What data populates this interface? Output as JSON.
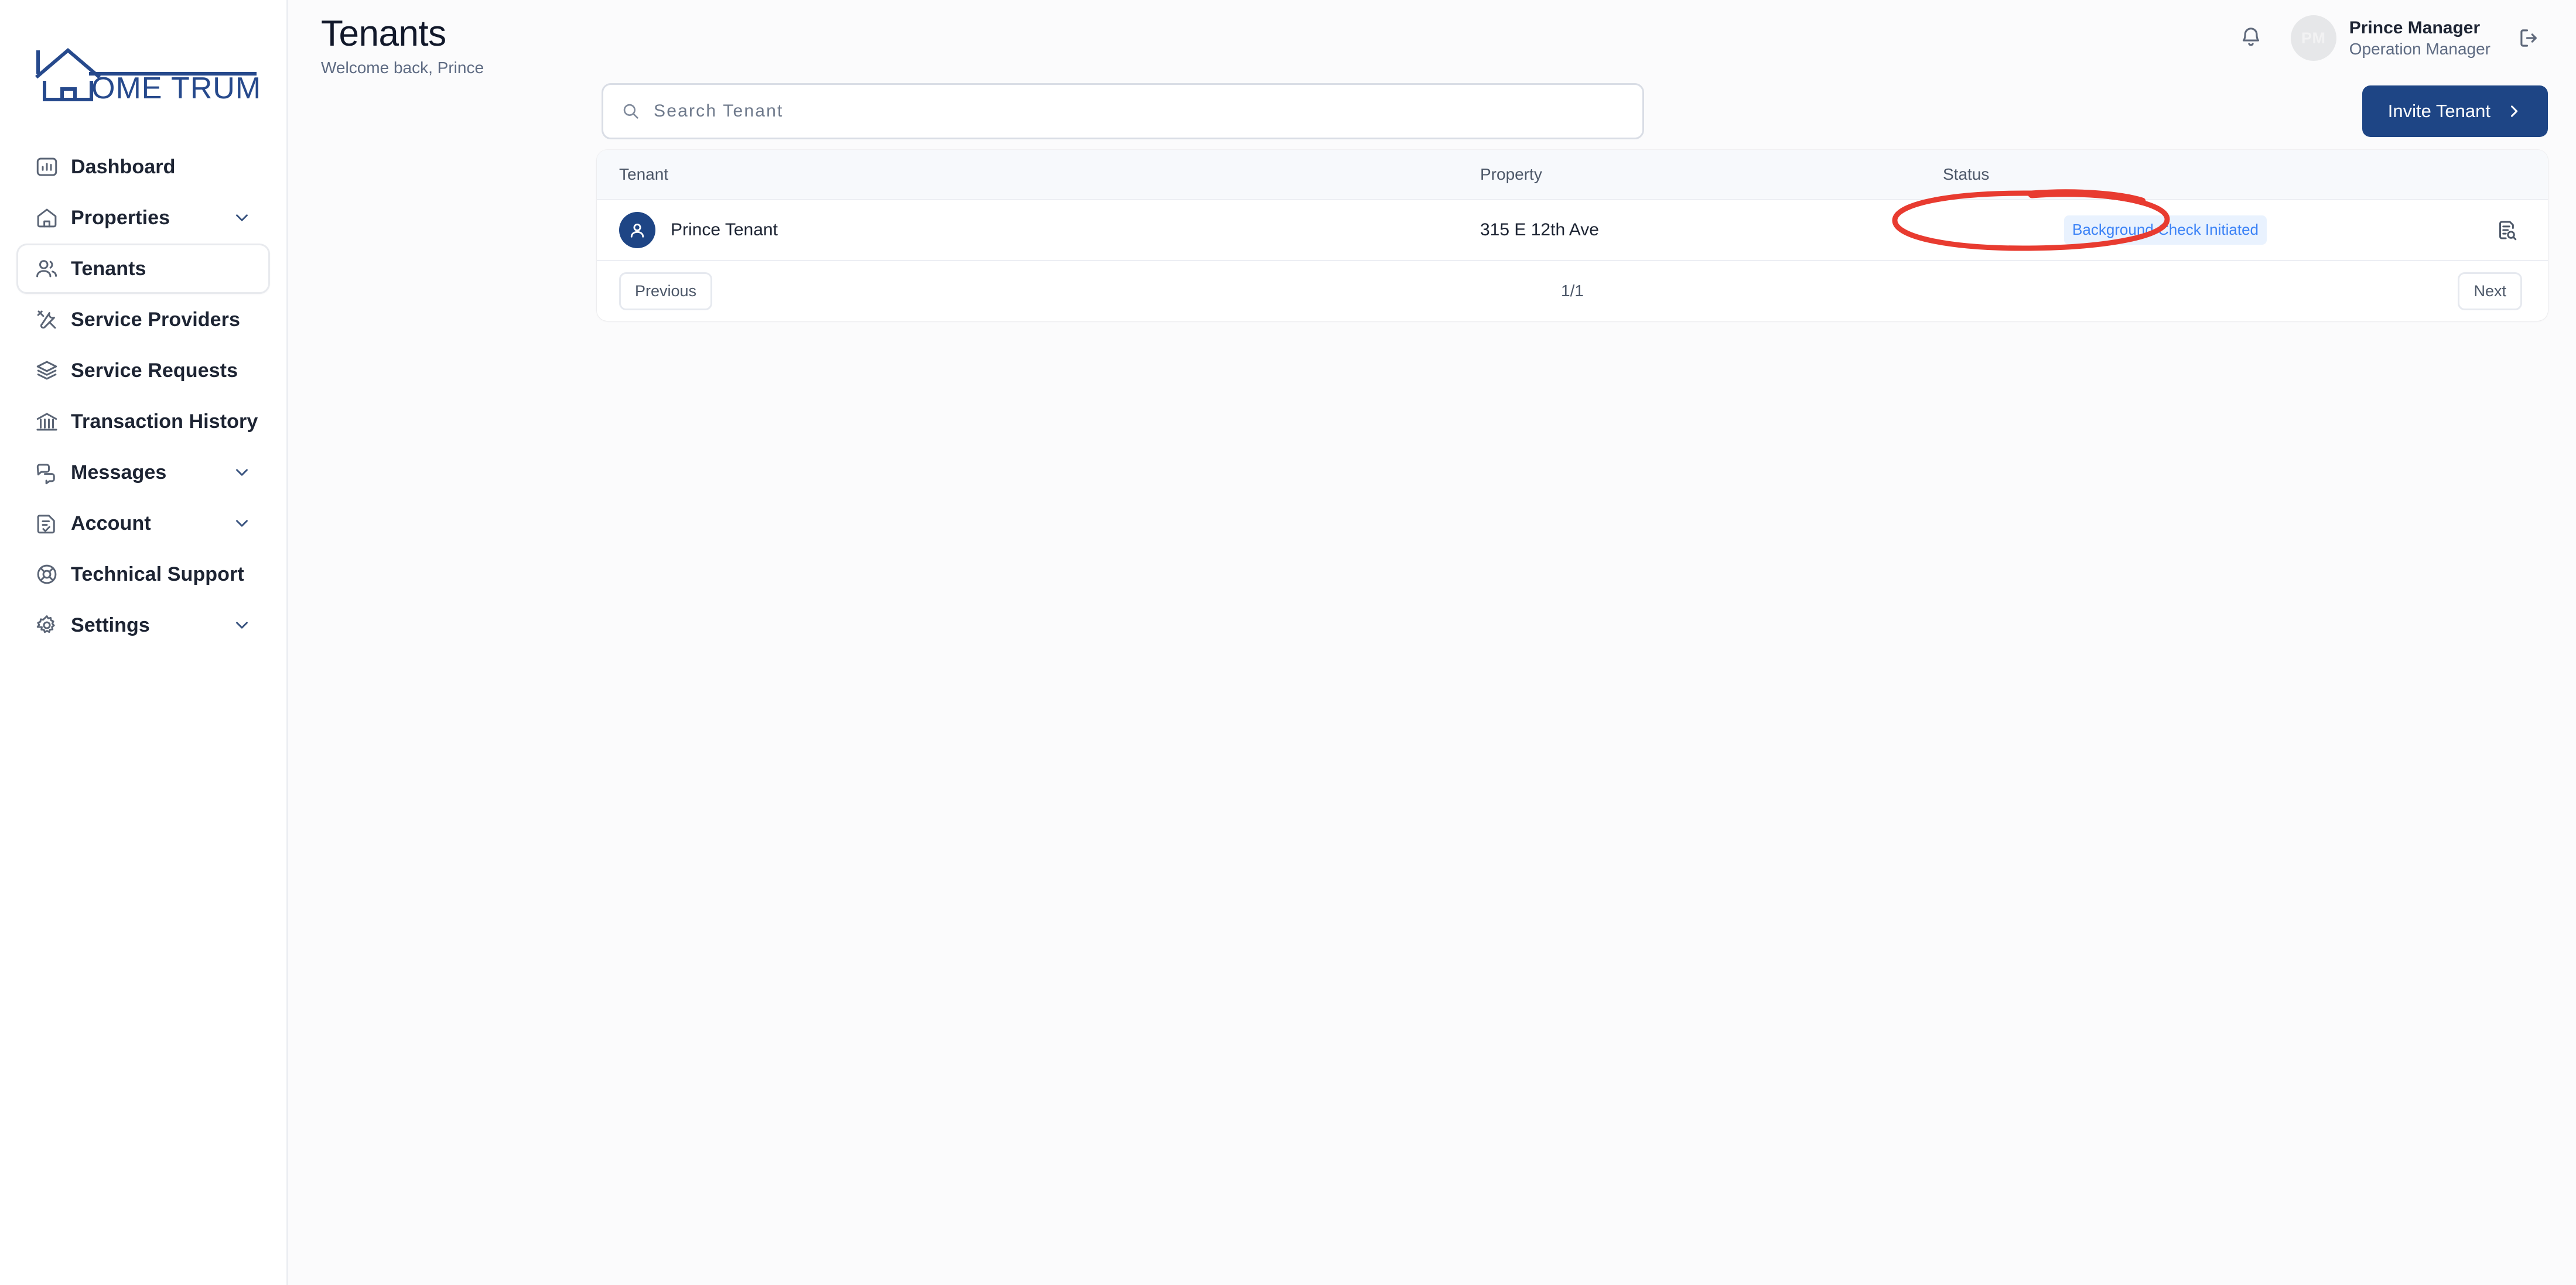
{
  "brand": {
    "logo_text": "OME TRUMPETER",
    "accent": "#1e4585"
  },
  "sidebar": {
    "items": [
      {
        "label": "Dashboard",
        "icon": "chart-bar-icon",
        "active": false,
        "chevron": false
      },
      {
        "label": "Properties",
        "icon": "home-icon",
        "active": false,
        "chevron": true
      },
      {
        "label": "Tenants",
        "icon": "users-icon",
        "active": true,
        "chevron": false
      },
      {
        "label": "Service Providers",
        "icon": "tools-icon",
        "active": false,
        "chevron": false
      },
      {
        "label": "Service Requests",
        "icon": "layers-icon",
        "active": false,
        "chevron": false
      },
      {
        "label": "Transaction History",
        "icon": "bank-icon",
        "active": false,
        "chevron": false
      },
      {
        "label": "Messages",
        "icon": "chat-bubbles-icon",
        "active": false,
        "chevron": true
      },
      {
        "label": "Account",
        "icon": "document-check-icon",
        "active": false,
        "chevron": true
      },
      {
        "label": "Technical Support",
        "icon": "lifebuoy-icon",
        "active": false,
        "chevron": false
      },
      {
        "label": "Settings",
        "icon": "gear-icon",
        "active": false,
        "chevron": true
      }
    ]
  },
  "header": {
    "title": "Tenants",
    "subtitle": "Welcome back, Prince",
    "notification_icon": "bell-icon",
    "logout_icon": "logout-icon",
    "user": {
      "initials": "PM",
      "name": "Prince Manager",
      "role": "Operation Manager"
    }
  },
  "search": {
    "placeholder": "Search Tenant",
    "value": "",
    "icon": "search-icon"
  },
  "actions": {
    "invite_label": "Invite Tenant",
    "invite_chevron": "chevron-right-icon"
  },
  "table": {
    "columns": [
      "Tenant",
      "Property",
      "Status"
    ],
    "rows": [
      {
        "tenant": "Prince Tenant",
        "tenant_avatar_icon": "user-icon",
        "property": "315 E 12th Ave",
        "status": "Background Check Initiated",
        "status_bg": "#e9f2fe",
        "status_color": "#3b82f6",
        "action_icon": "document-search-icon"
      }
    ]
  },
  "pagination": {
    "previous_label": "Previous",
    "next_label": "Next",
    "page_info": "1/1"
  },
  "annotation": {
    "shape": "ellipse",
    "color": "#e83b30",
    "target": "Background Check Initiated"
  }
}
